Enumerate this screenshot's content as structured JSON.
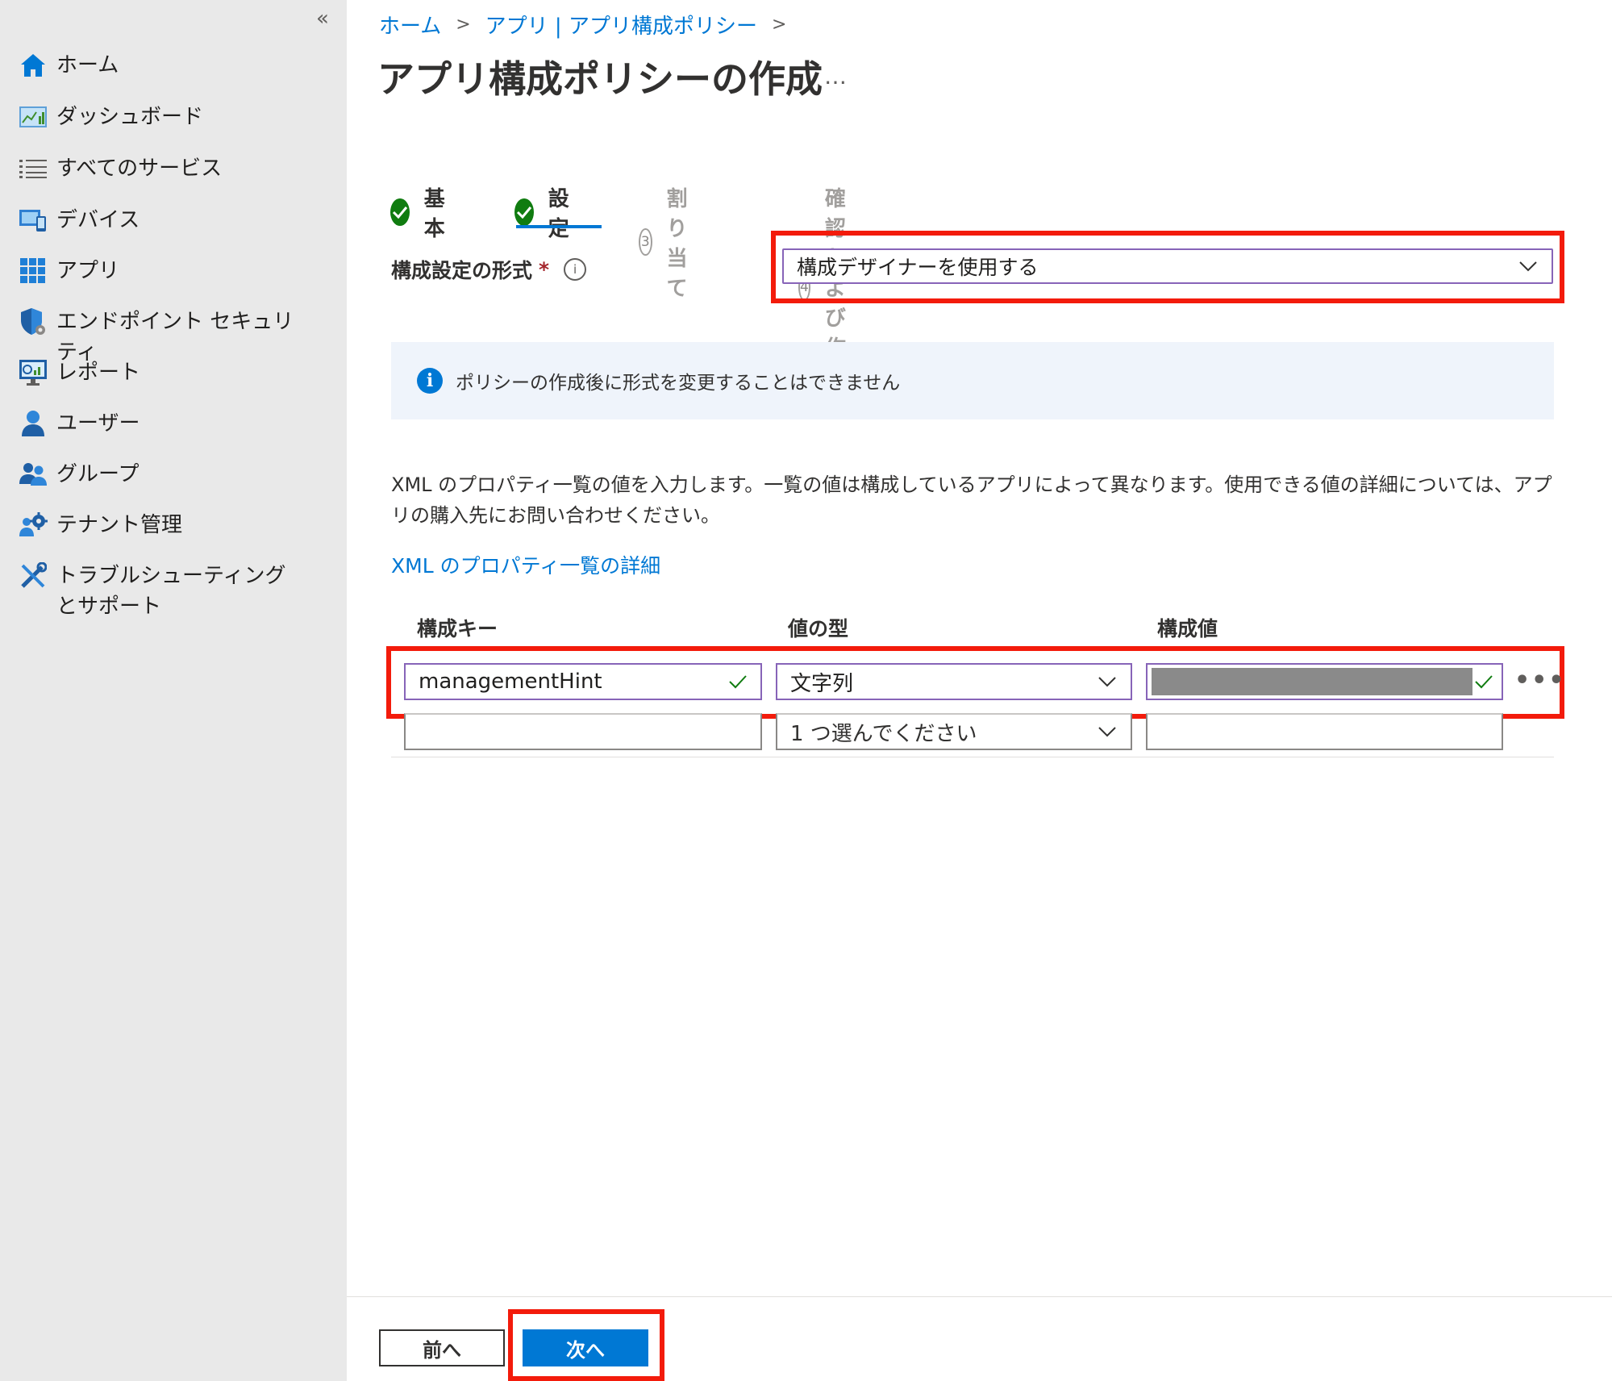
{
  "sidebar": {
    "collapse_label": "«",
    "items": [
      {
        "label": "ホーム",
        "icon": "home-icon"
      },
      {
        "label": "ダッシュボード",
        "icon": "dashboard-icon"
      },
      {
        "label": "すべてのサービス",
        "icon": "list-icon"
      },
      {
        "label": "デバイス",
        "icon": "devices-icon"
      },
      {
        "label": "アプリ",
        "icon": "apps-icon"
      },
      {
        "label": "エンドポイント セキュリティ",
        "icon": "shield-icon"
      },
      {
        "label": "レポート",
        "icon": "report-icon"
      },
      {
        "label": "ユーザー",
        "icon": "user-icon"
      },
      {
        "label": "グループ",
        "icon": "group-icon"
      },
      {
        "label": "テナント管理",
        "icon": "tenant-admin-icon"
      },
      {
        "label": "トラブルシューティングとサポート",
        "icon": "troubleshoot-icon"
      }
    ]
  },
  "breadcrumb": {
    "items": [
      "ホーム",
      "アプリ | アプリ構成ポリシー"
    ]
  },
  "page": {
    "title": "アプリ構成ポリシーの作成",
    "more": "…"
  },
  "wizard": {
    "steps": [
      {
        "number": "1",
        "label": "基本",
        "status": "done"
      },
      {
        "number": "2",
        "label": "設定",
        "status": "current"
      },
      {
        "number": "3",
        "label": "割り当て",
        "status": "todo"
      },
      {
        "number": "4",
        "label": "確認および作成",
        "status": "todo"
      }
    ]
  },
  "format": {
    "label": "構成設定の形式",
    "required": "*",
    "info": "i",
    "value": "構成デザイナーを使用する"
  },
  "info_bar": {
    "icon_text": "i",
    "message": "ポリシーの作成後に形式を変更することはできません"
  },
  "description": "XML のプロパティ一覧の値を入力します。一覧の値は構成しているアプリによって異なります。使用できる値の詳細については、アプリの購入先にお問い合わせください。",
  "learn_link": "XML のプロパティ一覧の詳細",
  "table": {
    "headers": [
      "構成キー",
      "値の型",
      "構成値"
    ],
    "rows": [
      {
        "key": "managementHint",
        "type": "文字列",
        "value": ""
      },
      {
        "key": "",
        "type": "1 つ選んでください",
        "value": ""
      }
    ],
    "more": "•••"
  },
  "footer": {
    "prev": "前へ",
    "next": "次へ"
  },
  "colors": {
    "accent": "#0078d4",
    "success": "#107c10",
    "highlight": "#f31b0b",
    "focus_border": "#8764b8"
  }
}
